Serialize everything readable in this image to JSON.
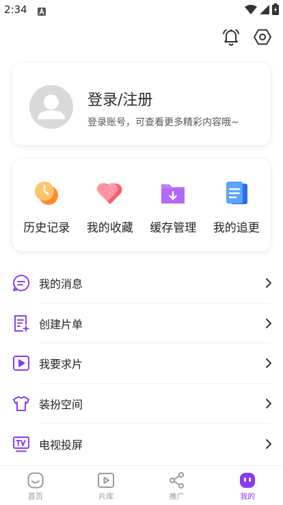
{
  "status": {
    "time": "2:34"
  },
  "colors": {
    "accent": "#8a3cf0",
    "text": "#222222",
    "muted": "#999999"
  },
  "top_icons": [
    "bell-icon",
    "settings-icon"
  ],
  "login": {
    "title": "登录/注册",
    "subtitle": "登录账号，可查看更多精彩内容哦~"
  },
  "shortcuts": [
    {
      "label": "历史记录",
      "icon": "history-icon"
    },
    {
      "label": "我的收藏",
      "icon": "favorites-icon"
    },
    {
      "label": "缓存管理",
      "icon": "download-folder-icon"
    },
    {
      "label": "我的追更",
      "icon": "following-icon"
    }
  ],
  "menu": [
    {
      "label": "我的消息",
      "icon": "message-icon"
    },
    {
      "label": "创建片单",
      "icon": "create-list-icon"
    },
    {
      "label": "我要求片",
      "icon": "request-video-icon"
    },
    {
      "label": "装扮空间",
      "icon": "shirt-icon"
    },
    {
      "label": "电视投屏",
      "icon": "tv-icon"
    }
  ],
  "tabs": [
    {
      "label": "首页",
      "icon": "home-icon"
    },
    {
      "label": "片库",
      "icon": "library-icon"
    },
    {
      "label": "推广",
      "icon": "share-icon"
    },
    {
      "label": "我的",
      "icon": "profile-icon",
      "active": true
    }
  ]
}
